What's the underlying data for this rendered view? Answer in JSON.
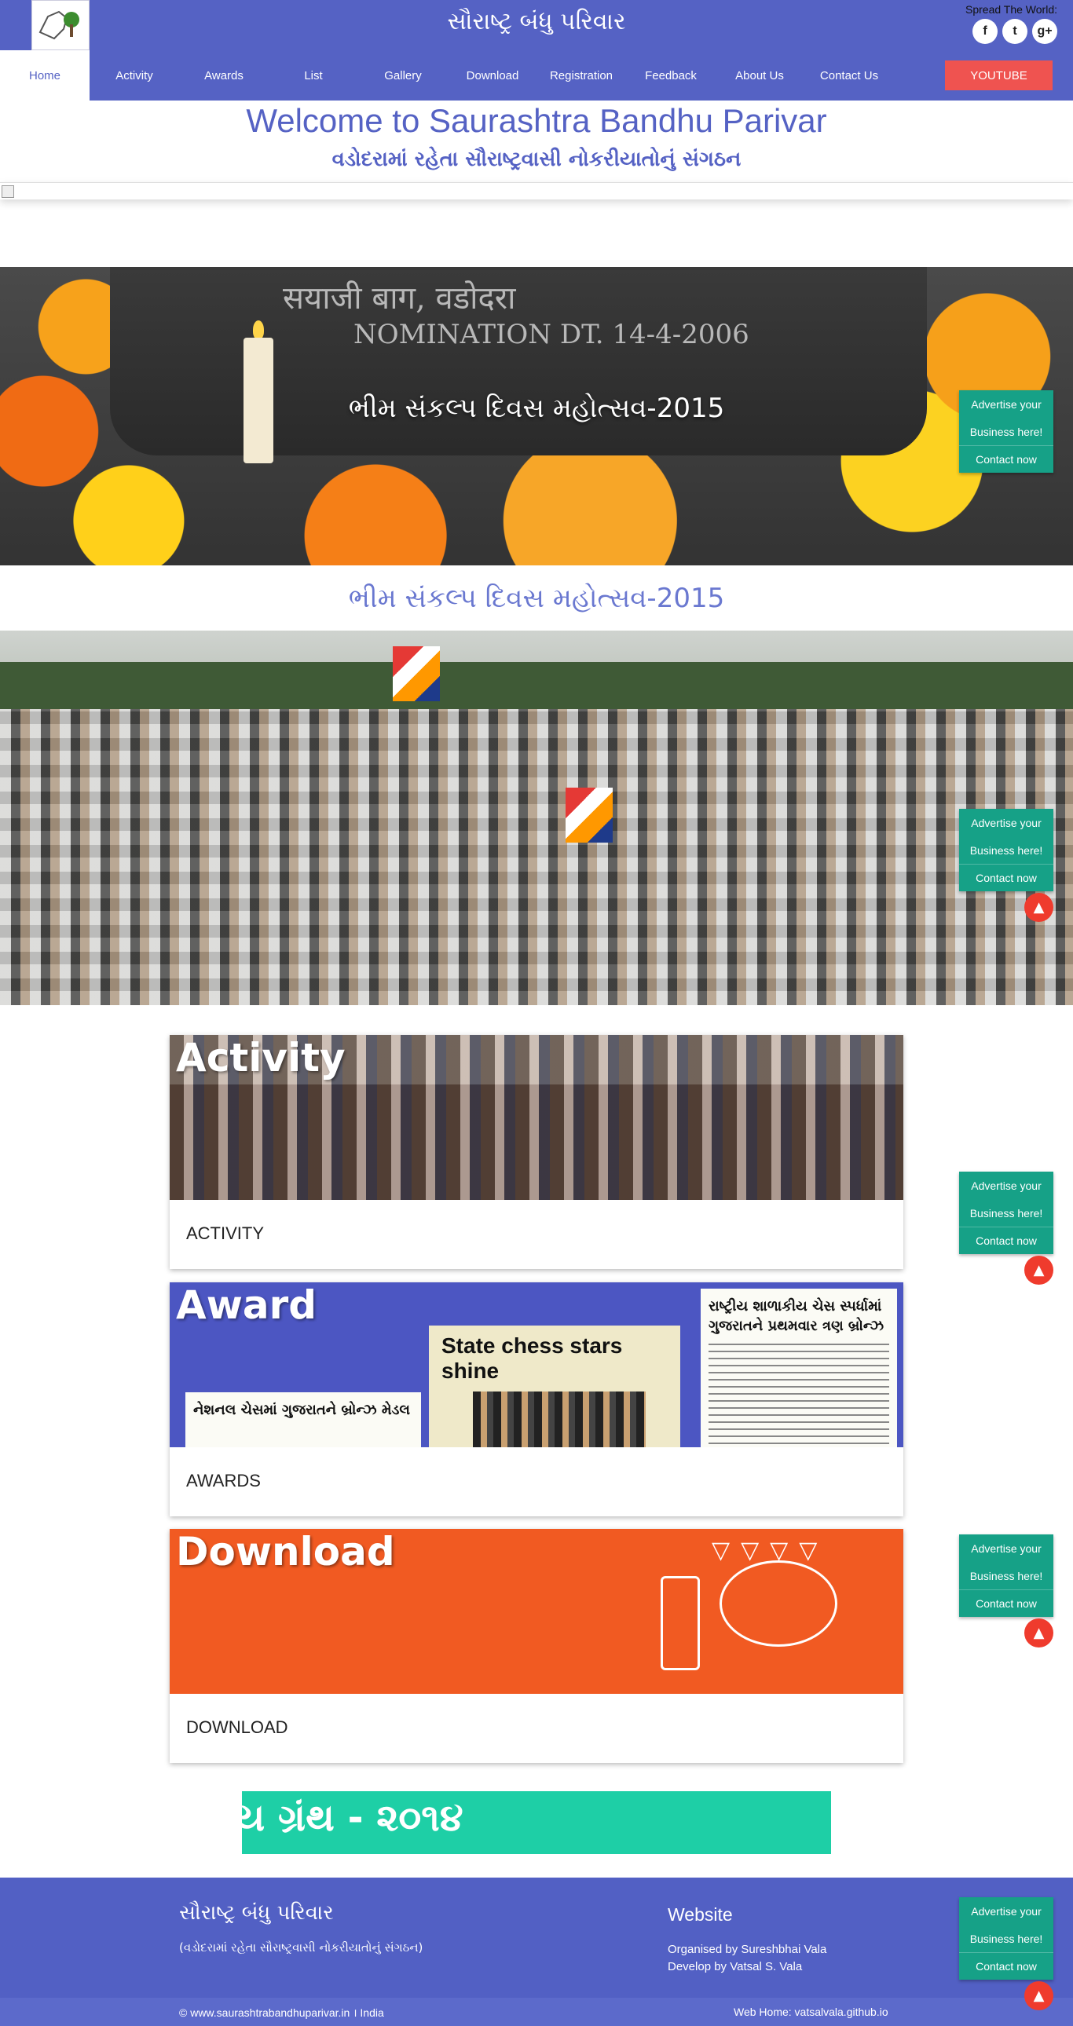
{
  "header": {
    "site_title": "સૌરાષ્ટ્ર બંધુ પરિવાર",
    "logo_icon": "map-logo-icon",
    "spread_label": "Spread The World:",
    "social": [
      {
        "icon": "facebook-icon",
        "glyph": "f"
      },
      {
        "icon": "twitter-icon",
        "glyph": "t"
      },
      {
        "icon": "google-plus-icon",
        "glyph": "g+"
      }
    ]
  },
  "nav": {
    "items": [
      "Home",
      "Activity",
      "Awards",
      "List",
      "Gallery",
      "Download",
      "Registration",
      "Feedback",
      "About Us",
      "Contact Us"
    ],
    "active": "Home",
    "youtube_label": "YOUTUBE",
    "youtube_color": "#ef5350"
  },
  "welcome": {
    "title": "Welcome to Saurashtra Bandhu Parivar",
    "subtitle": "વડોદરામાં રહેતા સૌરાષ્ટ્રવાસી નોકરીયાતોનું સંગઠન"
  },
  "hero": {
    "plaque_line1": "सयाजी बाग, वडोदरा",
    "plaque_line2": "NOMINATION DT. 14-4-2006",
    "caption": "ભીમ સંકલ્પ દિવસ મહોત્સવ-2015"
  },
  "section_heading": "ભીમ સંકલ્પ દિવસ મહોત્સવ-2015",
  "cards": [
    {
      "image_label": "Activity",
      "title": "ACTIVITY"
    },
    {
      "image_label": "Award",
      "title": "AWARDS",
      "clip1": "નેશનલ ચેસમાં ગુજરાતને બ્રોન્ઝ મેડલ",
      "clip2": "State chess stars shine",
      "clip3": "રાષ્ટ્રીય શાળાકીય ચેસ સ્પર્ધામાં ગુજરાતને પ્રથમવાર ત્રણ બ્રોન્ઝ"
    },
    {
      "image_label": "Download",
      "title": "DOWNLOAD"
    }
  ],
  "marquee_text": "ય ગ્રંથ - ૨૦૧૪",
  "footer": {
    "brand": "સૌરાષ્ટ્ર બંધુ પરિવાર",
    "tagline": "(વડોદરામાં રહેતા સૌરાષ્ટ્રવાસી નોકરીયાતોનું સંગઠન)",
    "website_heading": "Website",
    "organised": "Organised by Sureshbhai Vala",
    "developed": "Develop by Vatsal S. Vala",
    "copyright": "© www.saurashtrabandhuparivar.in । India",
    "web_home": "Web Home: vatsalvala.github.io"
  },
  "ad_widget": {
    "line1": "Advertise your",
    "line2": "Business here!",
    "line3": "Contact now",
    "color": "#16a187"
  },
  "scroll_top_icon": "arrow-up-icon",
  "colors": {
    "primary": "#5562c4",
    "accent_teal": "#1ecfa6",
    "download_orange": "#f15a22"
  }
}
